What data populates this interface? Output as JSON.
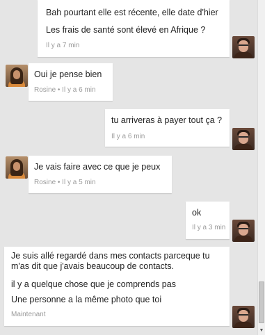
{
  "messages": [
    {
      "lines": [
        "Bah pourtant elle est récente, elle date d'hier",
        "Les frais de santé sont élevé en Afrique ?"
      ],
      "meta": "Il y a 7 min"
    },
    {
      "lines": [
        "Oui je pense bien"
      ],
      "meta": "Rosine • Il y a 6 min"
    },
    {
      "lines": [
        "tu arriveras à payer tout ça ?"
      ],
      "meta": "Il y a 6 min"
    },
    {
      "lines": [
        "Je vais faire avec ce que je peux"
      ],
      "meta": "Rosine • Il y a 5 min"
    },
    {
      "lines": [
        "ok"
      ],
      "meta": "Il y a 3 min"
    },
    {
      "lines": [
        "Je suis allé regardé dans mes contacts parceque tu m'as dit que j'avais beaucoup de contacts.",
        "il y a quelque chose que je comprends pas",
        "Une personne a la même photo que toi"
      ],
      "meta": "Maintenant"
    }
  ]
}
